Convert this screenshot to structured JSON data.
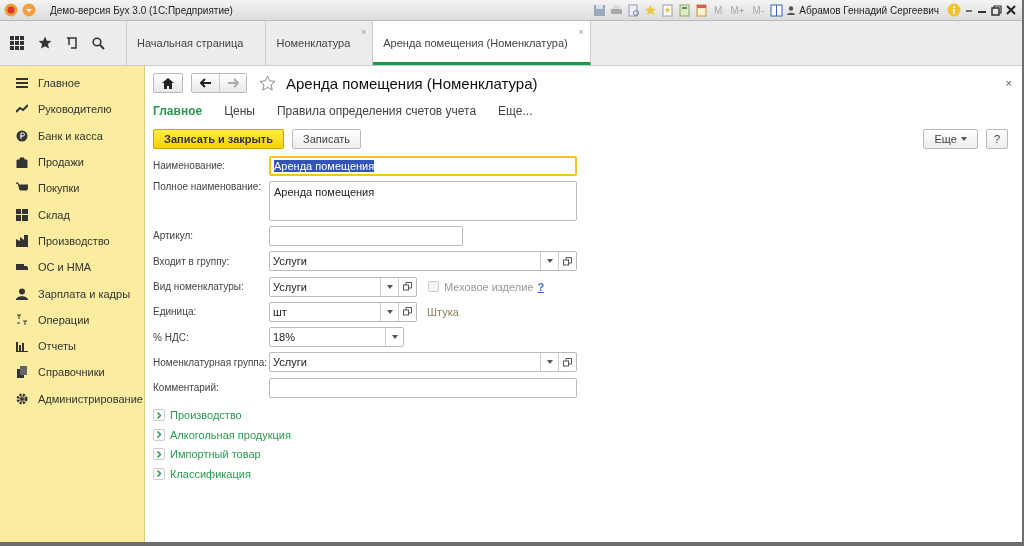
{
  "window": {
    "title": "Демо-версия Бух 3.0  (1С:Предприятие)",
    "memory_buttons": [
      "M",
      "M+",
      "M-"
    ],
    "user": "Абрамов Геннадий Сергеевич"
  },
  "tabs": [
    {
      "label": "Начальная страница",
      "selected": false
    },
    {
      "label": "Номенклатура",
      "selected": false,
      "close": "×"
    },
    {
      "label": "Аренда помещения (Номенклатура)",
      "selected": true,
      "close": "×"
    }
  ],
  "sidebar": {
    "items": [
      {
        "label": "Главное"
      },
      {
        "label": "Руководителю"
      },
      {
        "label": "Банк и касса"
      },
      {
        "label": "Продажи"
      },
      {
        "label": "Покупки"
      },
      {
        "label": "Склад"
      },
      {
        "label": "Производство"
      },
      {
        "label": "ОС и НМА"
      },
      {
        "label": "Зарплата и кадры"
      },
      {
        "label": "Операции"
      },
      {
        "label": "Отчеты"
      },
      {
        "label": "Справочники"
      },
      {
        "label": "Администрирование"
      }
    ]
  },
  "form": {
    "title": "Аренда помещения (Номенклатура)",
    "close": "×",
    "sections": [
      {
        "label": "Главное",
        "selected": true
      },
      {
        "label": "Цены",
        "selected": false
      },
      {
        "label": "Правила определения счетов учета",
        "selected": false
      },
      {
        "label": "Еще...",
        "selected": false
      }
    ],
    "primary_button": "Записать и закрыть",
    "save_button": "Записать",
    "more_button": "Еще",
    "help_button": "?",
    "fields": [
      {
        "label": "Наименование:",
        "kind": "text",
        "value": "Аренда помещения",
        "focused": true
      },
      {
        "label": "Полное наименование:",
        "kind": "textarea",
        "value": "Аренда помещения"
      },
      {
        "label": "Артикул:",
        "kind": "text-short"
      },
      {
        "label": "Входит в группу:",
        "kind": "ref",
        "value": "Услуги"
      },
      {
        "label": "Вид номенклатуры:",
        "kind": "ref-short",
        "value": "Услуги",
        "checkbox": {
          "label": "Меховое изделие",
          "checked": false,
          "disabled": true,
          "help": "?"
        }
      },
      {
        "label": "Единица:",
        "kind": "ref-short",
        "value": "шт",
        "note": "Штука"
      },
      {
        "label": "% НДС:",
        "kind": "list-short",
        "value": "18%"
      },
      {
        "label": "Номенклатурная группа:",
        "kind": "ref",
        "value": "Услуги"
      },
      {
        "label": "Комментарий:",
        "kind": "text"
      }
    ],
    "groups": [
      {
        "label": "Производство",
        "expanded": false
      },
      {
        "label": "Алкогольная продукция",
        "expanded": false
      },
      {
        "label": "Импортный товар",
        "expanded": false
      },
      {
        "label": "Классификация",
        "expanded": false
      }
    ]
  }
}
